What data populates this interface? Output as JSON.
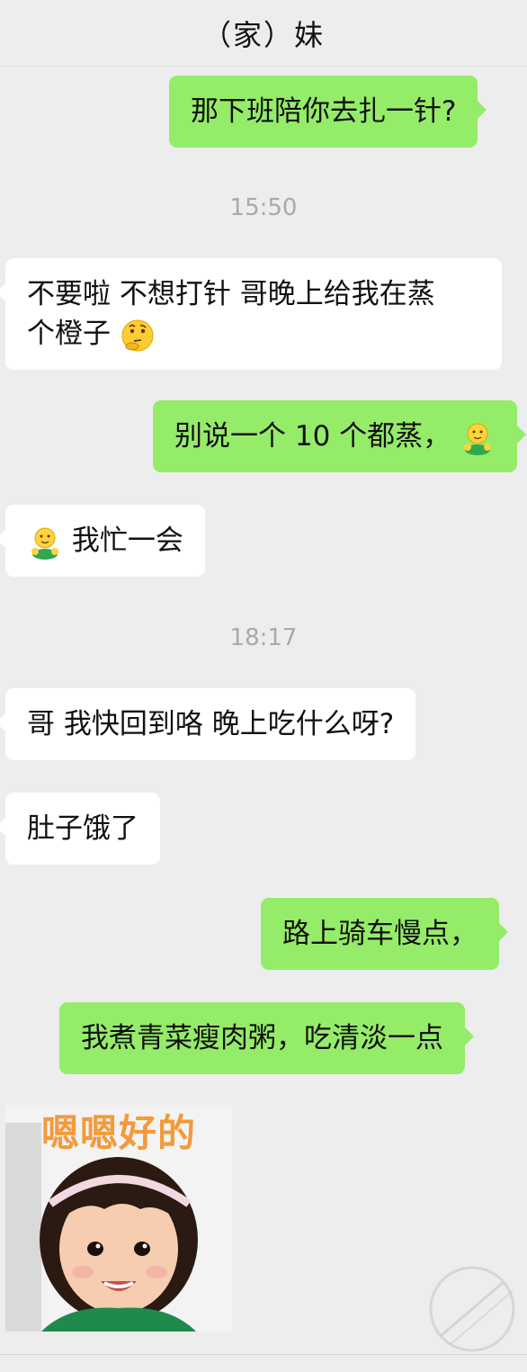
{
  "header": {
    "title": "（家）妹"
  },
  "messages": {
    "m1": "那下班陪你去扎一针?",
    "t1": "15:50",
    "m2a": "不要啦 不想打针 哥晚上给我在蒸",
    "m2b": "个橙子",
    "m3": "别说一个 10 个都蒸，",
    "m4": "我忙一会",
    "t2": "18:17",
    "m5": "哥 我快回到咯 晚上吃什么呀?",
    "m6": "肚子饿了",
    "m7": "路上骑车慢点，",
    "m8": "我煮青菜瘦肉粥，吃清淡一点",
    "sticker_caption": "嗯嗯好的"
  },
  "icons": {
    "thinking": "thinking-face-emoji",
    "hug": "hugging-face-emoji"
  },
  "colors": {
    "background": "#ededed",
    "incoming_bubble": "#ffffff",
    "outgoing_bubble": "#95ec69",
    "timestamp": "#a9a9a9"
  }
}
